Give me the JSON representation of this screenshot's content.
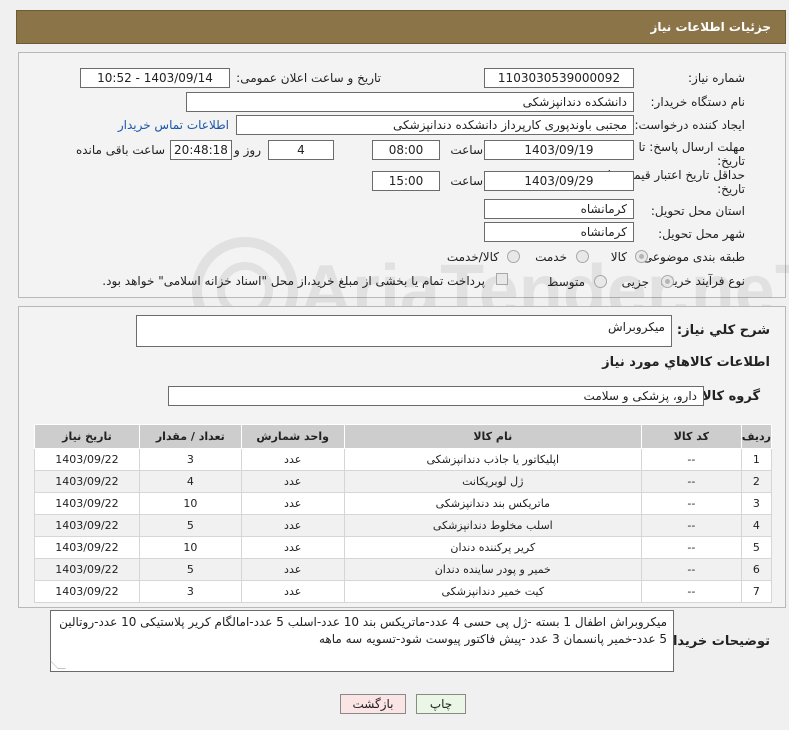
{
  "header": {
    "title": "جزئیات اطلاعات نیاز"
  },
  "form": {
    "need_number_label": "شماره نیاز:",
    "need_number": "1103030539000092",
    "announce_label": "تاریخ و ساعت اعلان عمومی:",
    "announce_value": "1403/09/14 - 10:52",
    "buyer_org_label": "نام دستگاه خریدار:",
    "buyer_org": "دانشکده دندانپزشکی",
    "creator_label": "ایجاد کننده درخواست:",
    "creator": "مجتبی  باوندپوری کارپرداز دانشکده دندانپزشکی",
    "contact_link": "اطلاعات تماس خریدار",
    "deadline_label_1": "مهلت ارسال پاسخ: تا",
    "deadline_label_2": "تاریخ:",
    "deadline_date": "1403/09/19",
    "time_label": "ساعت",
    "deadline_time": "08:00",
    "days_value": "4",
    "days_label": "روز و",
    "remaining_time": "20:48:18",
    "remaining_label": "ساعت باقی مانده",
    "validity_label_1": "حداقل تاریخ اعتبار قیمت: تا",
    "validity_label_2": "تاریخ:",
    "validity_date": "1403/09/29",
    "validity_time_label": "ساعت",
    "validity_time": "15:00",
    "province_label": "استان محل تحویل:",
    "province": "کرمانشاه",
    "city_label": "شهر محل تحویل:",
    "city": "کرمانشاه",
    "category_label": "طبقه بندی موضوعی:",
    "category_options": [
      "کالا",
      "خدمت",
      "کالا/خدمت"
    ],
    "process_label": "نوع فرآیند خرید :",
    "process_options": [
      "جزیی",
      "متوسط"
    ],
    "payment_note": "پرداخت تمام یا بخشی از مبلغ خرید،از محل \"اسناد خزانه اسلامی\" خواهد بود."
  },
  "summary": {
    "label": "شرح کلي نياز:",
    "value": "میکروبراش"
  },
  "goods": {
    "section_title": "اطلاعات کالاهاي مورد نياز",
    "group_label": "گروه کالا:",
    "group_value": "دارو، پزشکی و سلامت"
  },
  "table": {
    "headers": [
      "ردیف",
      "کد کالا",
      "نام کالا",
      "واحد شمارش",
      "تعداد / مقدار",
      "تاریخ نیاز"
    ],
    "rows": [
      [
        "1",
        "--",
        "اپلیکاتور یا جاذب دندانپزشکی",
        "عدد",
        "3",
        "1403/09/22"
      ],
      [
        "2",
        "--",
        "ژل لوبریکانت",
        "عدد",
        "4",
        "1403/09/22"
      ],
      [
        "3",
        "--",
        "ماتریکس بند دندانپزشکی",
        "عدد",
        "10",
        "1403/09/22"
      ],
      [
        "4",
        "--",
        "اسلب مخلوط دندانپزشکی",
        "عدد",
        "5",
        "1403/09/22"
      ],
      [
        "5",
        "--",
        "کریر پرکننده دندان",
        "عدد",
        "10",
        "1403/09/22"
      ],
      [
        "6",
        "--",
        "خمیر و پودر ساینده دندان",
        "عدد",
        "5",
        "1403/09/22"
      ],
      [
        "7",
        "--",
        "کیت خمیر دندانپزشکی",
        "عدد",
        "3",
        "1403/09/22"
      ]
    ]
  },
  "notes": {
    "label": "توضیحات خریدار:",
    "text": "میکروبراش اطفال 1 بسته -ژل پی حسی 4 عدد-ماتریکس بند 10 عدد-اسلب 5 عدد-امالگام کریر پلاستیکی 10 عدد-روتالین 5 عدد-خمیر پانسمان 3 عدد  -پیش فاکتور پیوست شود-تسویه سه ماهه"
  },
  "buttons": {
    "print": "چاپ",
    "back": "بازگشت"
  },
  "watermark": "AriaTender.neT"
}
